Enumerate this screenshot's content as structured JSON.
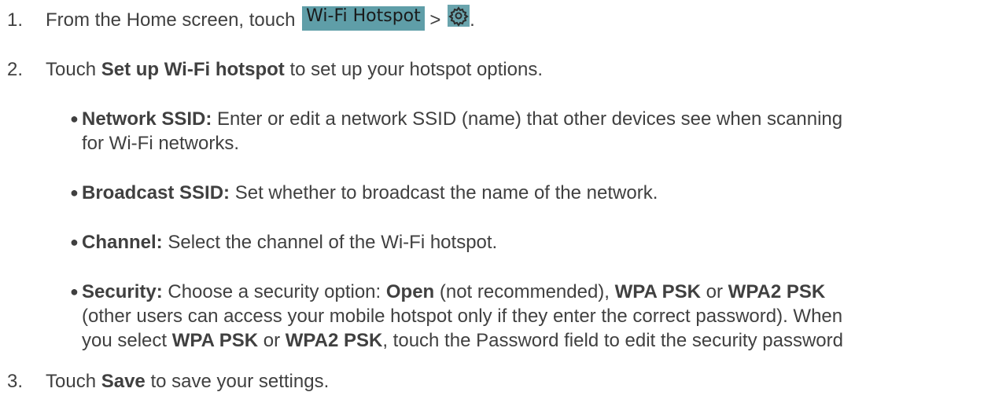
{
  "steps": [
    {
      "num": "1.",
      "pre": "From the Home screen, touch ",
      "button_label": "Wi-Fi Hotspot",
      "sep": " > ",
      "icon": "gear-icon",
      "post": "."
    },
    {
      "num": "2.",
      "pre": "Touch ",
      "bold": "Set up Wi-Fi hotspot",
      "post": " to set up your hotspot options.",
      "bullets": [
        {
          "term": "Network SSID:",
          "lines": [
            " Enter or edit a network SSID (name) that other devices see when scanning",
            "for Wi-Fi networks."
          ]
        },
        {
          "term": "Broadcast SSID:",
          "text": " Set whether to broadcast the name of the network."
        },
        {
          "term": "Channel:",
          "text": " Select the channel of the Wi-Fi hotspot."
        },
        {
          "term": "Security:",
          "t1": " Choose a security option: ",
          "b1": "Open",
          "t2": " (not recommended), ",
          "b2": "WPA PSK",
          "t3": " or ",
          "b3": "WPA2 PSK",
          "line2": "(other users can access your mobile hotspot only if they enter the correct password). When",
          "t4": "you select ",
          "b4": "WPA PSK",
          "t5": " or ",
          "b5": "WPA2 PSK",
          "t6": ", touch the Password field to edit the security password"
        }
      ]
    },
    {
      "num": "3.",
      "pre": "Touch ",
      "bold": "Save",
      "post": " to save your settings."
    }
  ],
  "colors": {
    "text": "#404040",
    "button_bg": "#5f9ea8",
    "icon_bg": "#6aa4ad"
  }
}
